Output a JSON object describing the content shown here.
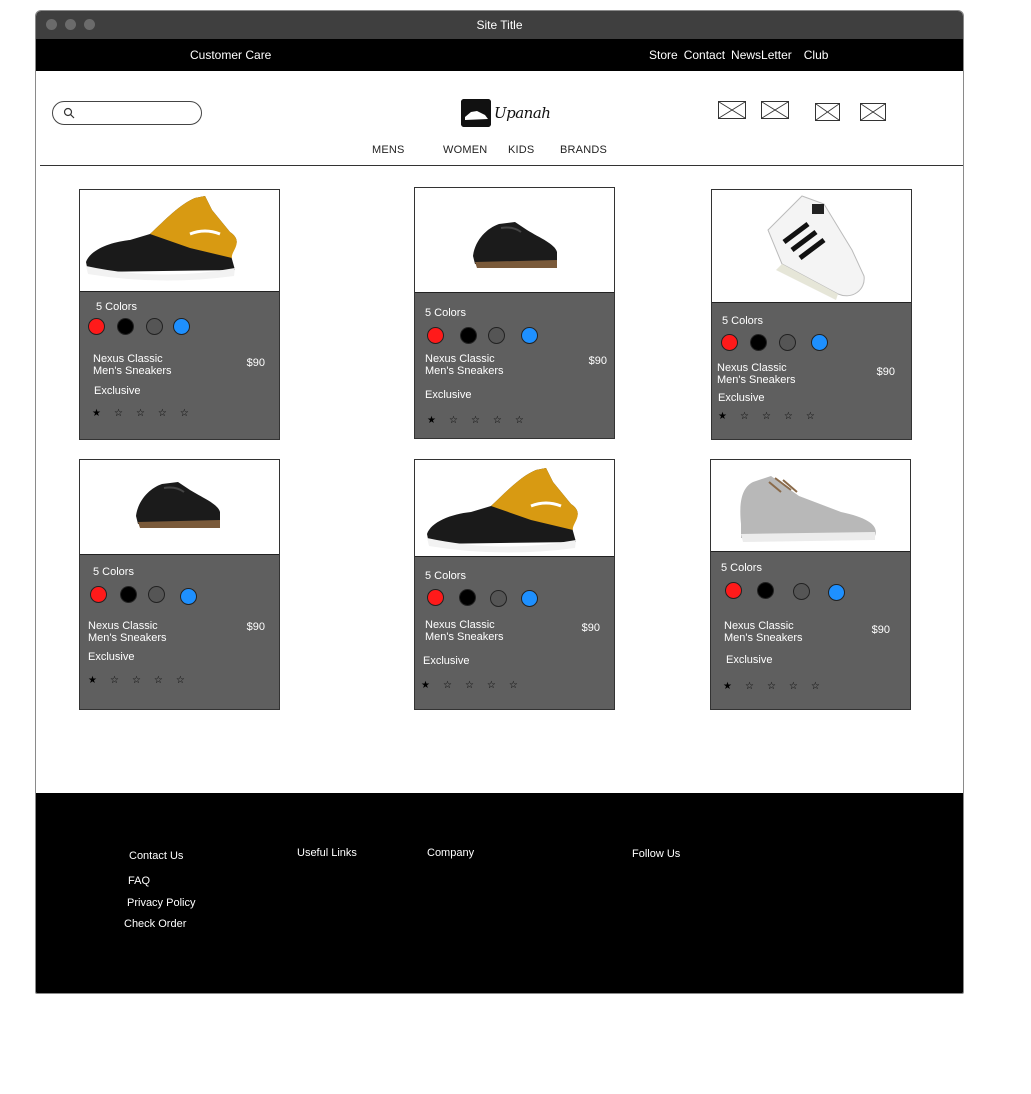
{
  "window": {
    "title": "Site Title"
  },
  "topbar": {
    "customer_care": "Customer Care",
    "links": [
      "Store",
      "Contact",
      "NewsLetter",
      "Club"
    ]
  },
  "header": {
    "logo_text": "Upanah",
    "search": {
      "placeholder": "",
      "value": ""
    },
    "icons": [
      "image-placeholder-icon",
      "image-placeholder-icon",
      "image-placeholder-icon",
      "image-placeholder-icon"
    ]
  },
  "nav": {
    "items": [
      "MENS",
      "WOMEN",
      "KIDS",
      "BRANDS"
    ]
  },
  "products": [
    {
      "colors_label": "5 Colors",
      "swatches": [
        "#ff1a1a",
        "#000000",
        "#555555",
        "#1e90ff"
      ],
      "name_line1": "Nexus Classic",
      "name_line2": "Men's Sneakers",
      "price": "$90",
      "badge": "Exclusive",
      "rating": 1,
      "max_rating": 5,
      "image": "gold-black-sneaker"
    },
    {
      "colors_label": "5 Colors",
      "swatches": [
        "#ff1a1a",
        "#000000",
        "#555555",
        "#1e90ff"
      ],
      "name_line1": "Nexus Classic",
      "name_line2": "Men's Sneakers",
      "price": "$90",
      "badge": "Exclusive",
      "rating": 1,
      "max_rating": 5,
      "image": "black-leather-shoe"
    },
    {
      "colors_label": "5 Colors",
      "swatches": [
        "#ff1a1a",
        "#000000",
        "#555555",
        "#1e90ff"
      ],
      "name_line1": "Nexus Classic",
      "name_line2": "Men's Sneakers",
      "price": "$90",
      "badge": "Exclusive",
      "rating": 1,
      "max_rating": 5,
      "image": "white-striped-sneaker"
    },
    {
      "colors_label": "5 Colors",
      "swatches": [
        "#ff1a1a",
        "#000000",
        "#555555",
        "#1e90ff"
      ],
      "name_line1": "Nexus Classic",
      "name_line2": "Men's Sneakers",
      "price": "$90",
      "badge": "Exclusive",
      "rating": 1,
      "max_rating": 5,
      "image": "black-leather-shoe"
    },
    {
      "colors_label": "5 Colors",
      "swatches": [
        "#ff1a1a",
        "#000000",
        "#555555",
        "#1e90ff"
      ],
      "name_line1": "Nexus Classic",
      "name_line2": "Men's Sneakers",
      "price": "$90",
      "badge": "Exclusive",
      "rating": 1,
      "max_rating": 5,
      "image": "gold-black-sneaker"
    },
    {
      "colors_label": "5 Colors",
      "swatches": [
        "#ff1a1a",
        "#000000",
        "#555555",
        "#1e90ff"
      ],
      "name_line1": "Nexus Classic",
      "name_line2": "Men's Sneakers",
      "price": "$90",
      "badge": "Exclusive",
      "rating": 1,
      "max_rating": 5,
      "image": "grey-knit-sneaker"
    }
  ],
  "footer": {
    "contact_us": "Contact Us",
    "faq": "FAQ",
    "privacy_policy": "Privacy Policy",
    "check_order": "Check Order",
    "useful_links": "Useful Links",
    "company": "Company",
    "follow_us": "Follow Us"
  },
  "colors": {
    "titlebar": "#3f3f3f",
    "topbar": "#000000",
    "card_panel": "#5f5f5f",
    "footer": "#000000"
  }
}
